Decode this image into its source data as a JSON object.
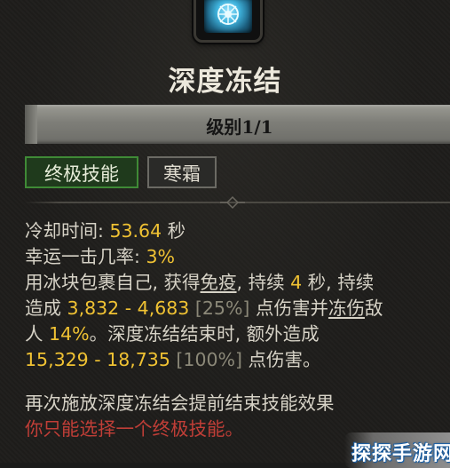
{
  "skill": {
    "icon": "frost-nova-icon",
    "name": "深度冻结",
    "rank_label": "级别1/1",
    "tags": [
      "终极技能",
      "寒霜"
    ]
  },
  "description": {
    "cooldown_label": "冷却时间: ",
    "cooldown_value": "53.64",
    "cooldown_unit": " 秒",
    "lucky_label": "幸运一击几率: ",
    "lucky_value": "3%",
    "line3_a": "用冰块包裹自己, 获得",
    "line3_immune": "免疫",
    "line3_b": ", 持续 ",
    "line3_dur": "4",
    "line3_c": " 秒, 持续",
    "line4_a": "造成 ",
    "line4_dmg": "3,832 - 4,683",
    "line4_pct": " [25%]",
    "line4_b": " 点伤害并",
    "line4_freeze": "冻伤",
    "line4_c": "敌",
    "line5_a": "人 ",
    "line5_val": "14%",
    "line5_b": "。深度冻结结束时, 额外造成",
    "line6_dmg": "15,329 - 18,735",
    "line6_pct": " [100%]",
    "line6_b": " 点伤害。",
    "line7": "再次施放深度冻结会提前结束技能效果",
    "line8": "你只能选择一个终极技能。"
  },
  "watermark": "探探手游网",
  "colors": {
    "value": "#f0c233",
    "dim": "#8b8878",
    "ultimate_tag_border": "#3f8a36",
    "warning": "#c03e37",
    "frost_icon": "#3fb3dd"
  }
}
